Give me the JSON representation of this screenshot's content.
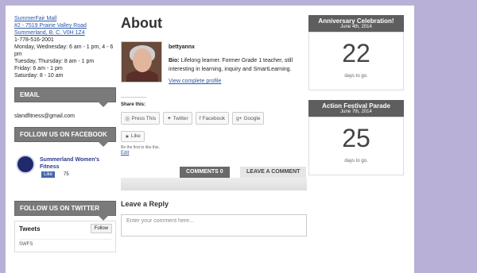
{
  "left": {
    "address_links": [
      "SummerFair Mall",
      "#2 - 7519 Prairie Valley Road",
      "Summerland, B. C. V0H 1Z4"
    ],
    "address_lines": [
      "1-778-516-2001",
      "Monday, Wednesday: 6 am - 1 pm, 4 - 6 pm",
      "Tuesday, Thursday: 8 am - 1 pm",
      "Friday: 6 am - 1 pm",
      "Saturday: 8 - 10 am"
    ],
    "email_title": "EMAIL",
    "email": "slandfitness@gmail.com",
    "facebook_title": "FOLLOW US ON FACEBOOK",
    "facebook_name": "Summerland Women's Fitness",
    "facebook_like": "Like",
    "facebook_count": "75",
    "twitter_title": "FOLLOW US ON TWITTER",
    "tweets_label": "Tweets",
    "follow_label": "Follow",
    "tweet_row": "SWFS"
  },
  "main": {
    "title": "About",
    "author_name": "bettyannx",
    "bio_label": "Bio:",
    "bio": "Lifelong learner. Former Grade 1 teacher, still interesting in learning, inquiry and SmartLearning.",
    "profile_link": "View complete profile",
    "share_label": "Share this:",
    "share_buttons": [
      "Press This",
      "Twitter",
      "Facebook",
      "Google"
    ],
    "like_label": "Like",
    "like_note": "Be the first to like this.",
    "edit_label": "Edit",
    "tab_comments": "COMMENTS 0",
    "tab_leave": "LEAVE A COMMENT",
    "reply_title": "Leave a Reply",
    "comment_placeholder": "Enter your comment here..."
  },
  "right": {
    "countdowns": [
      {
        "title": "Anniversary Celebration!",
        "date": "June 4th, 2014",
        "days": "22",
        "label": "days to go."
      },
      {
        "title": "Action Festival Parade",
        "date": "June 7th, 2014",
        "days": "25",
        "label": "days to go."
      }
    ]
  }
}
